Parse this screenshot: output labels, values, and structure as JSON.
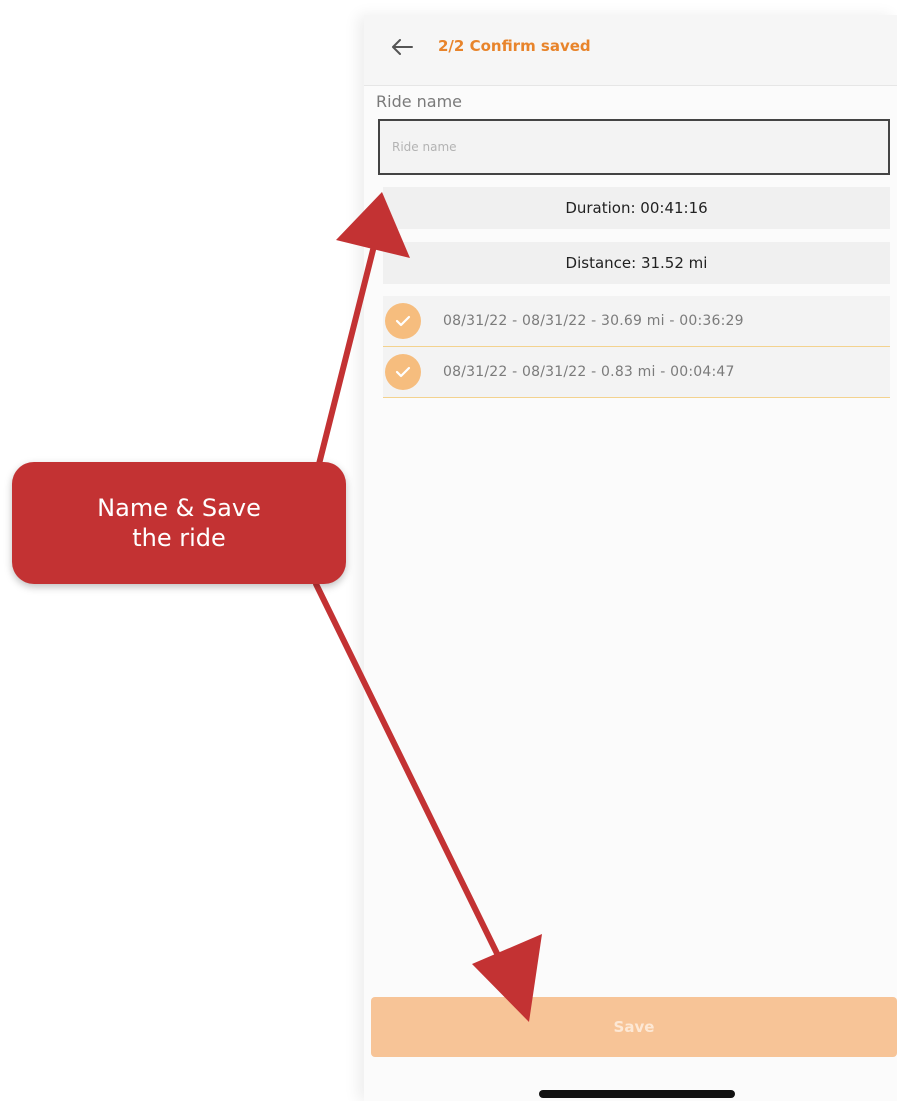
{
  "header": {
    "title": "2/2 Confirm saved",
    "back_icon": "arrow-left-icon"
  },
  "ride_name": {
    "label": "Ride name",
    "placeholder": "Ride name",
    "value": ""
  },
  "stats": {
    "duration": "Duration: 00:41:16",
    "distance": "Distance: 31.52 mi"
  },
  "segments": [
    {
      "label": "08/31/22 - 08/31/22 - 30.69 mi - 00:36:29",
      "checked": true
    },
    {
      "label": "08/31/22 - 08/31/22 - 0.83 mi - 00:04:47",
      "checked": true
    }
  ],
  "save_button": {
    "label": "Save"
  },
  "callout": {
    "text": "Name & Save\nthe ride"
  },
  "colors": {
    "accent": "#e8842b",
    "check": "#f6bd7e",
    "save_button_disabled": "#f7c497",
    "callout": "#c33233"
  }
}
